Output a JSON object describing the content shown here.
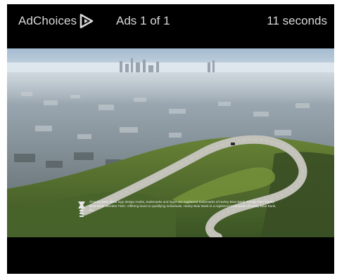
{
  "ad_bar": {
    "adchoices_label": "AdChoices",
    "adchoices_icon": "adchoices-triangle-icon",
    "ad_count": "Ads 1 of 1",
    "countdown": "11 seconds"
  },
  "video": {
    "disclaimer": "©Harley Bear Bank logo design marks, trademarks and logos are registered trademarks of Harley Bear Bank. Private from Harley Bear Bank Member FDIC. Offering loans to qualifying individuals. Harley Bear Bank is a registered trademark of Harley Bear Bank, Inc.",
    "disclaimer_logo": "bank-logo-icon"
  },
  "colors": {
    "player_background": "#000000",
    "bar_text": "#d9d9d9"
  }
}
